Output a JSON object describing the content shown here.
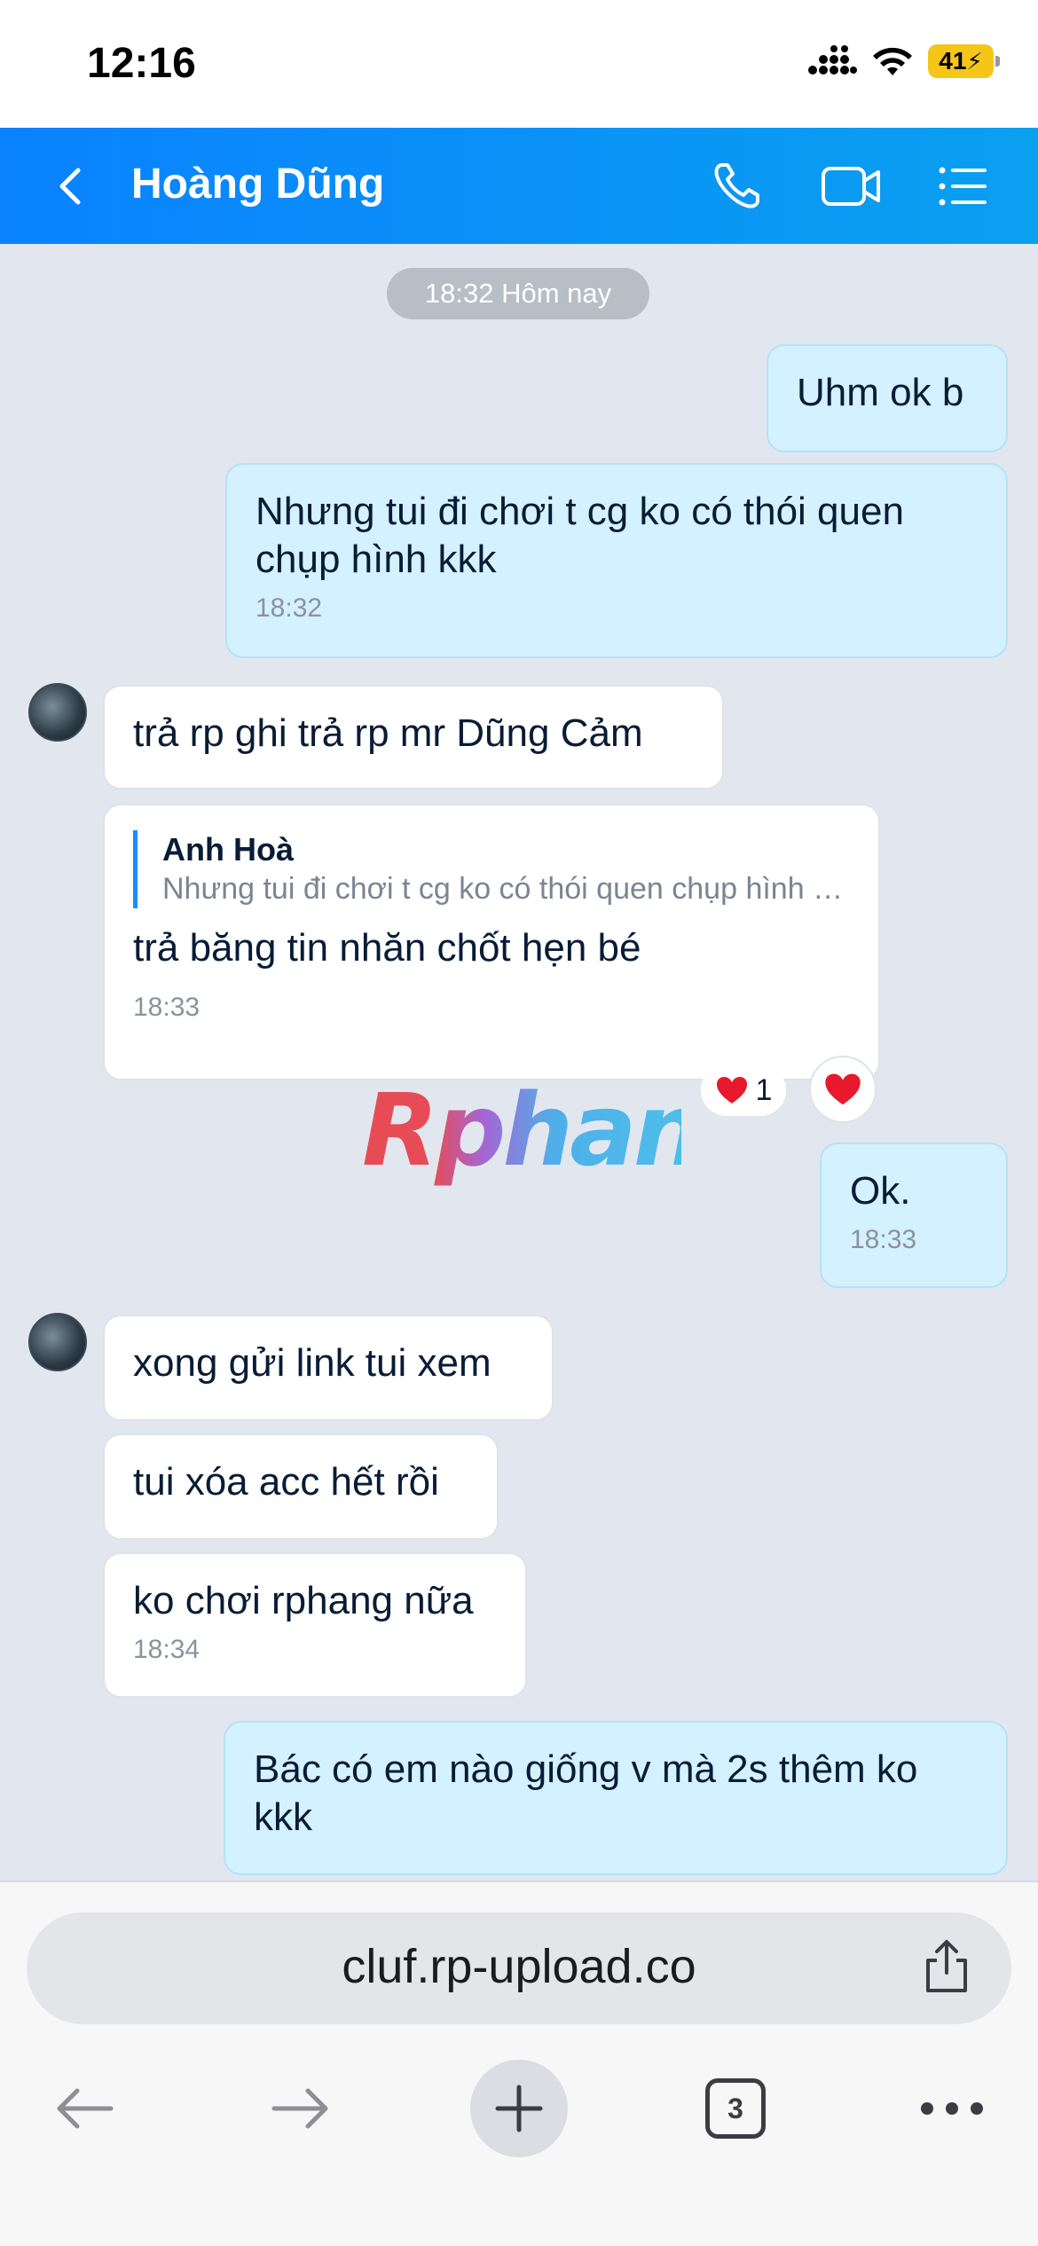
{
  "status_bar": {
    "time": "12:16",
    "battery": "41",
    "icons": [
      "signal-icon",
      "wifi-icon",
      "battery-icon"
    ]
  },
  "header": {
    "contact_name": "Hoàng Dũng",
    "icons": [
      "back-icon",
      "phone-icon",
      "video-call-icon",
      "menu-list-icon"
    ],
    "accent_color": "#0a82ff"
  },
  "chat": {
    "date_separator": "18:32 Hôm nay",
    "messages": [
      {
        "sender": "me",
        "text": "Uhm ok b",
        "time": ""
      },
      {
        "sender": "me",
        "text": "Nhưng tui đi chơi t cg ko có thói quen chụp hình kkk",
        "time": "18:32"
      },
      {
        "sender": "them",
        "text": "trả rp ghi trả rp mr Dũng Cảm",
        "time": ""
      },
      {
        "sender": "them",
        "quote_author": "Anh Hoà",
        "quote_text": "Nhưng tui đi chơi t cg ko có thói quen chụp hình kkk",
        "text": "trả băng tin nhăn chốt hẹn bé",
        "time": "18:33",
        "reaction_count": "1"
      },
      {
        "sender": "me",
        "text": "Ok.",
        "time": "18:33"
      },
      {
        "sender": "them",
        "text": "xong gửi link tui xem",
        "time": ""
      },
      {
        "sender": "them",
        "text": "tui xóa acc hết rồi",
        "time": ""
      },
      {
        "sender": "them",
        "text": "ko chơi rphang nữa",
        "time": "18:34"
      },
      {
        "sender": "me",
        "text": "Bác có em nào giống v mà 2s thêm ko kkk",
        "time": ""
      }
    ],
    "watermark": "Rphang"
  },
  "browser": {
    "url": "cluf.rp-upload.co",
    "tab_count": "3",
    "icons": [
      "back-arrow-icon",
      "forward-arrow-icon",
      "new-tab-plus-icon",
      "tabs-icon",
      "more-icon",
      "share-icon"
    ]
  }
}
